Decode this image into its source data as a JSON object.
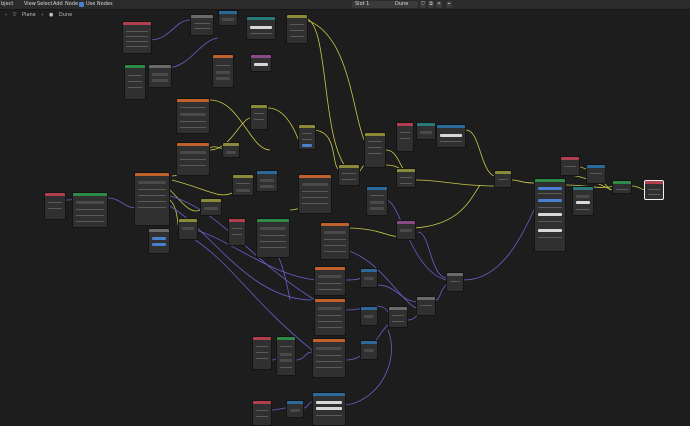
{
  "topbar": {
    "menus": [
      "bject",
      "View",
      "Select",
      "Add",
      "Node"
    ],
    "use_nodes_label": "Use Nodes",
    "slot_value": "Slot 1",
    "material_value": "Dune"
  },
  "breadcrumb": {
    "object": "Plane",
    "material": "Dune"
  },
  "colors": {
    "background": "#1d1d1d",
    "wire_yellow": "#c8c84a",
    "wire_purple": "#6a5fc8",
    "header_orange": "#c0602a",
    "header_purple": "#8a4a8a",
    "header_red": "#b04050",
    "header_blue": "#2a6a9a",
    "header_green": "#2f8a4a",
    "header_olive": "#8a8a3a",
    "header_teal": "#2a7a7a",
    "header_grey": "#6a6a6a"
  }
}
